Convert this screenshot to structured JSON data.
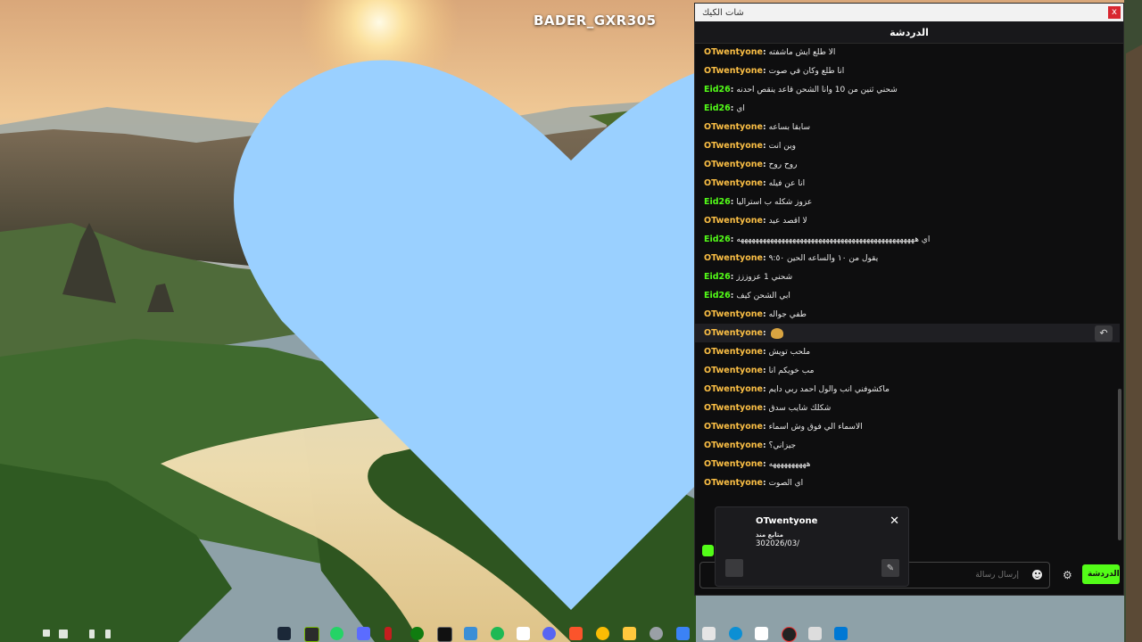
{
  "wallpaper": {
    "overlay_text": "BADER_GXR305"
  },
  "window": {
    "title": "شات الكيك",
    "close_glyph": "x"
  },
  "chat": {
    "header": "الدردشة",
    "colors": {
      "user_orange": "#fbbf45",
      "user_green": "#53fc18",
      "text": "#e8e8e8"
    },
    "messages": [
      {
        "user": "OTwentyone",
        "text": "الا طلع ايش ماشفته",
        "color": "orange"
      },
      {
        "user": "OTwentyone",
        "text": "انا طلع وكان في صوت",
        "color": "orange"
      },
      {
        "user": "Eid26",
        "text": "شحني ثنين من 10 وانا الشحن قاعد ينقص احدنه",
        "color": "green"
      },
      {
        "user": "Eid26",
        "text": "اي",
        "color": "green"
      },
      {
        "user": "OTwentyone",
        "text": "سابقا بساعه",
        "color": "orange"
      },
      {
        "user": "OTwentyone",
        "text": "وين انت",
        "color": "orange"
      },
      {
        "user": "OTwentyone",
        "text": "روح روح",
        "color": "orange"
      },
      {
        "user": "OTwentyone",
        "text": "انا عن فيله",
        "color": "orange"
      },
      {
        "user": "Eid26",
        "text": "عزوز شكله ب استراليا",
        "color": "green"
      },
      {
        "user": "OTwentyone",
        "text": "لا اقصد عيد",
        "color": "orange"
      },
      {
        "user": "Eid26",
        "text": "اي ههههههههههههههههههههههههههههههههههههههههههههههههه",
        "color": "green"
      },
      {
        "user": "OTwentyone",
        "text": "يقول من ١٠ والساعه الحين ٩:٥٠",
        "color": "orange"
      },
      {
        "user": "Eid26",
        "text": "شحني 1 عزوززز",
        "color": "green"
      },
      {
        "user": "Eid26",
        "text": "ابي الشحن كيف",
        "color": "green"
      },
      {
        "user": "OTwentyone",
        "text": "طفي جواله",
        "color": "orange"
      },
      {
        "user": "OTwentyone",
        "text": "",
        "color": "orange",
        "emote": true,
        "highlighted": true
      },
      {
        "user": "OTwentyone",
        "text": "ملحب تويش",
        "color": "orange"
      },
      {
        "user": "OTwentyone",
        "text": "مب خويكم انا",
        "color": "orange"
      },
      {
        "user": "OTwentyone",
        "text": "ماكشوفني انب والول احمد ربي دايم",
        "color": "orange"
      },
      {
        "user": "OTwentyone",
        "text": "شكلك شايب سدق",
        "color": "orange"
      },
      {
        "user": "OTwentyone",
        "text": "الاسماء الي فوق وش اسماء",
        "color": "orange"
      },
      {
        "user": "OTwentyone",
        "text": "جيزاني؟",
        "color": "orange"
      },
      {
        "user": "OTwentyone",
        "text": "ههههههههههه",
        "color": "orange"
      },
      {
        "user": "OTwentyone",
        "text": "اي الصوت",
        "color": "orange"
      }
    ],
    "input": {
      "placeholder": "إرسال رسالة"
    },
    "send_label": "الدردشة"
  },
  "user_card": {
    "name": "OTwentyone",
    "label": "متابع منذ",
    "date": "302026/03/",
    "close_glyph": "✕"
  },
  "icons": {
    "heart": "heart-icon",
    "reply": "reply-icon",
    "gear": "gear-icon",
    "emoji": "emoji-icon"
  }
}
